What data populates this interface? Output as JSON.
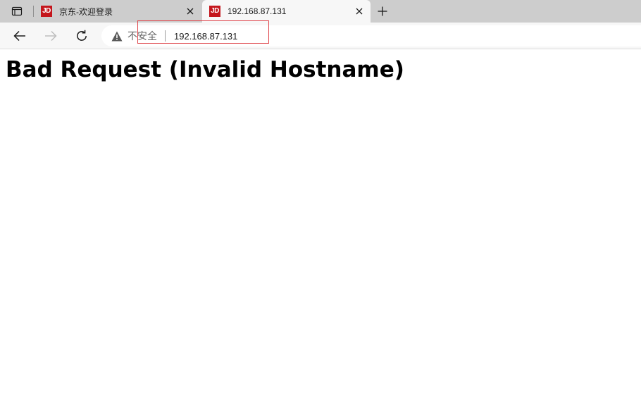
{
  "tabs": [
    {
      "favicon_text": "JD",
      "title": "京东-欢迎登录",
      "active": false
    },
    {
      "favicon_text": "JD",
      "title": "192.168.87.131",
      "active": true
    }
  ],
  "toolbar": {
    "security_label": "不安全",
    "url": "192.168.87.131"
  },
  "page": {
    "heading": "Bad Request (Invalid Hostname)"
  },
  "colors": {
    "favicon_bg": "#c4161c",
    "highlight_border": "#e0474c",
    "tabstrip_bg": "#cdcdcd",
    "toolbar_bg": "#f7f7f7"
  },
  "icons": {
    "tab_actions": "tab-actions-icon",
    "close": "close-icon",
    "new_tab": "plus-icon",
    "back": "back-arrow-icon",
    "forward": "forward-arrow-icon",
    "reload": "reload-icon",
    "warning": "warning-triangle-icon"
  }
}
